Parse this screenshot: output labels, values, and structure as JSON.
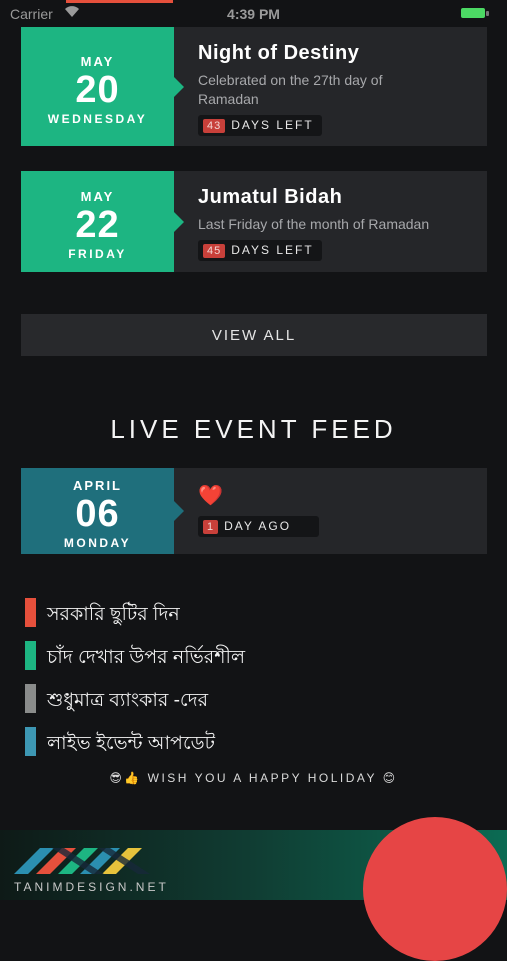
{
  "status_bar": {
    "carrier": "Carrier",
    "time": "4:39 PM"
  },
  "events": [
    {
      "month": "MAY",
      "day": "20",
      "weekday": "WEDNESDAY",
      "title": "Night of Destiny",
      "description": "Celebrated on the 27th day of Ramadan",
      "count": "43",
      "count_label": "DAYS LEFT"
    },
    {
      "month": "MAY",
      "day": "22",
      "weekday": "FRIDAY",
      "title": "Jumatul Bidah",
      "description": "Last Friday of the month of Ramadan",
      "count": "45",
      "count_label": "DAYS LEFT"
    }
  ],
  "view_all_label": "VIEW ALL",
  "live_feed": {
    "title": "LIVE EVENT FEED",
    "item": {
      "month": "APRIL",
      "day": "06",
      "weekday": "MONDAY",
      "emoji": "❤️",
      "count": "1",
      "count_label": "DAY AGO"
    }
  },
  "legend": [
    {
      "label": "সরকারি ছুটির দিন",
      "color": "#e6503c"
    },
    {
      "label": "চাঁদ দেখার উপর নর্ভিরশীল",
      "color": "#1db582"
    },
    {
      "label": "শুধুমাত্র ব্যাংকার -দের",
      "color": "#8a8c8b"
    },
    {
      "label": "লাইভ ইভেন্ট আপডেট",
      "color": "#3d97b3"
    }
  ],
  "wish": {
    "emoji_left": "😎👍",
    "text": "WISH YOU A HAPPY HOLIDAY",
    "emoji_right": "😊"
  },
  "footer": {
    "brand": "TANIMDESIGN.NET"
  },
  "icons": {
    "fab": "add-button-circle",
    "logo": "tanimdesign-logo"
  }
}
